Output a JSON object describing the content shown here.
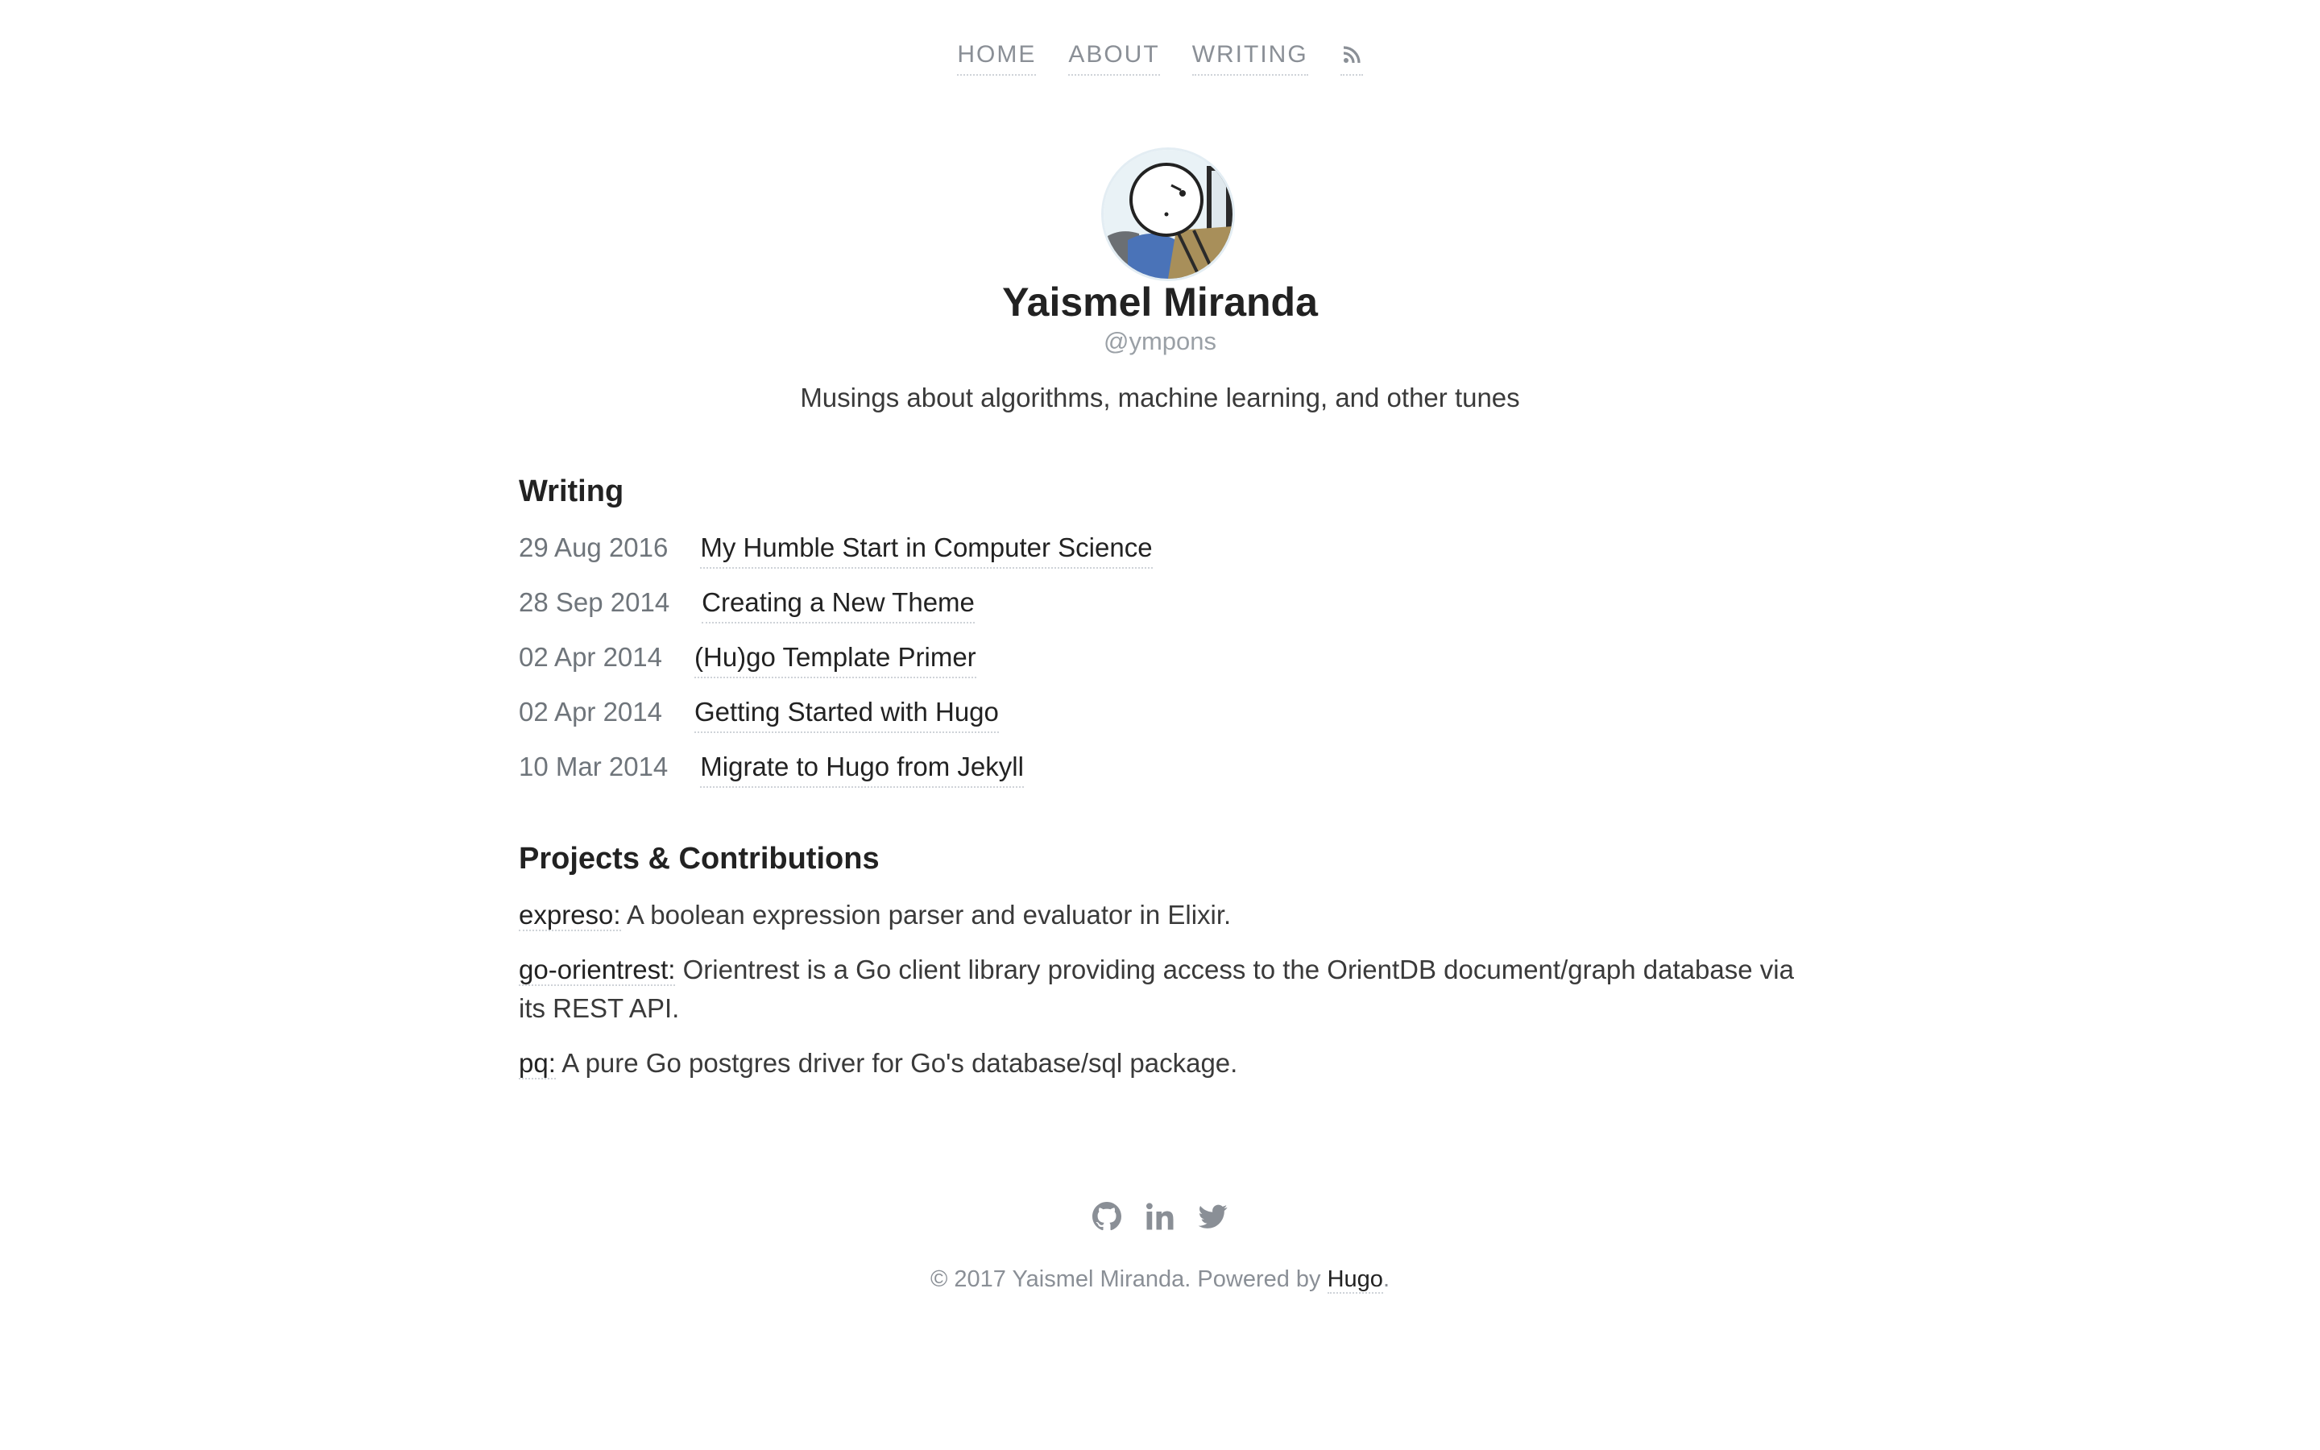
{
  "nav": {
    "items": [
      {
        "label": "HOME"
      },
      {
        "label": "ABOUT"
      },
      {
        "label": "WRITING"
      }
    ],
    "rss_icon": "rss-icon"
  },
  "profile": {
    "name": "Yaismel Miranda",
    "handle": "@ympons",
    "tagline": "Musings about algorithms, machine learning, and other tunes",
    "avatar_icon": "avatar"
  },
  "writing": {
    "title": "Writing",
    "posts": [
      {
        "date": "29 Aug 2016",
        "title": "My Humble Start in Computer Science"
      },
      {
        "date": "28 Sep 2014",
        "title": "Creating a New Theme"
      },
      {
        "date": "02 Apr 2014",
        "title": "(Hu)go Template Primer"
      },
      {
        "date": "02 Apr 2014",
        "title": "Getting Started with Hugo"
      },
      {
        "date": "10 Mar 2014",
        "title": "Migrate to Hugo from Jekyll"
      }
    ]
  },
  "projects": {
    "title": "Projects & Contributions",
    "items": [
      {
        "name": "expreso:",
        "description": " A boolean expression parser and evaluator in Elixir."
      },
      {
        "name": "go-orientrest:",
        "description": " Orientrest is a Go client library providing access to the OrientDB document/graph database via its REST API."
      },
      {
        "name": "pq:",
        "description": " A pure Go postgres driver for Go's database/sql package."
      }
    ]
  },
  "footer": {
    "social_icons": [
      "github-icon",
      "linkedin-icon",
      "twitter-icon"
    ],
    "copyright": "© 2017 Yaismel Miranda. Powered by ",
    "link": "Hugo",
    "end": "."
  },
  "colors": {
    "text": "#333333",
    "muted": "#8a8f96",
    "heading": "#222222",
    "link_underline": "#cfd3d8"
  }
}
